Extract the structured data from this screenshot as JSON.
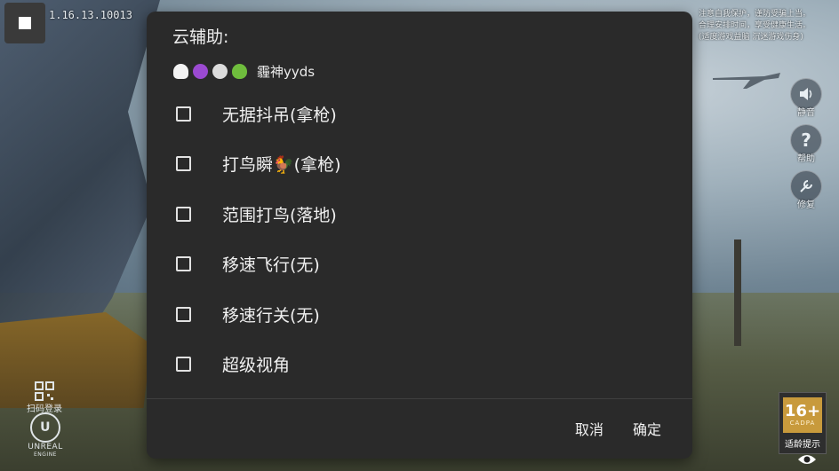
{
  "game": {
    "version": "1.16.13.10013",
    "notice_lines": [
      "注意自我保护，谨防受骗上当。",
      "合理安排时间，享受健康生活。",
      "(适度游戏益脑 沉迷游戏伤身)"
    ],
    "side_buttons": [
      {
        "label": "静音",
        "icon": "speaker-icon"
      },
      {
        "label": "帮助",
        "icon": "help-icon"
      },
      {
        "label": "修复",
        "icon": "wrench-icon"
      }
    ],
    "scan_login": "扫码登录",
    "engine_logo": "UNREAL",
    "engine_logo_sub": "ENGINE",
    "age_rating": {
      "age": "16+",
      "org": "CADPA",
      "tip": "适龄提示"
    }
  },
  "dialog": {
    "title": "云辅助:",
    "subtitle_emojis": [
      "ghost-emoji",
      "devil-emoji",
      "skull-emoji",
      "alien-emoji"
    ],
    "subtitle_text": "霾神yyds",
    "options": [
      {
        "label": "无据抖吊(拿枪)",
        "checked": false
      },
      {
        "label": "打鸟瞬🐓(拿枪)",
        "checked": false
      },
      {
        "label": "范围打鸟(落地)",
        "checked": false
      },
      {
        "label": "移速飞行(无)",
        "checked": false
      },
      {
        "label": "移速行关(无)",
        "checked": false
      },
      {
        "label": "超级视角",
        "checked": false
      }
    ],
    "cancel_label": "取消",
    "confirm_label": "确定"
  },
  "colors": {
    "dialog_bg": "#2a2a2a",
    "text": "#f1f1f1",
    "age_badge": "#c89a3c"
  }
}
